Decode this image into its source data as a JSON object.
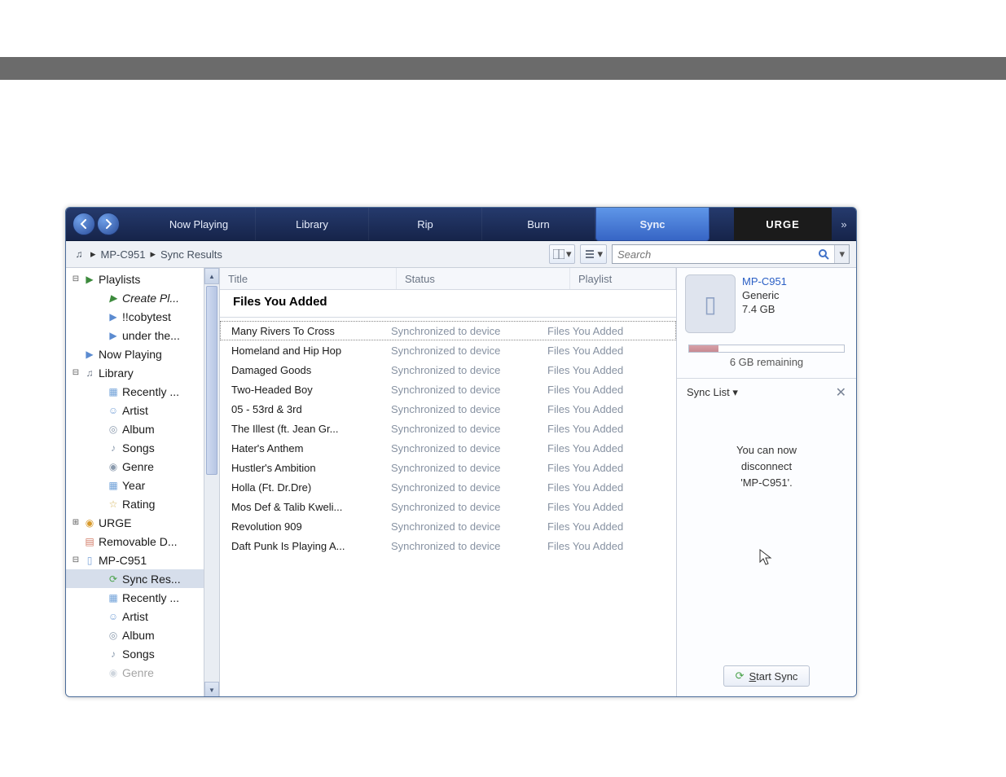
{
  "toolbar": {
    "tabs": [
      "Now Playing",
      "Library",
      "Rip",
      "Burn",
      "Sync"
    ],
    "active_index": 4,
    "urge": "URGE"
  },
  "breadcrumb": {
    "segments": [
      "MP-C951",
      "Sync Results"
    ]
  },
  "search": {
    "placeholder": "Search"
  },
  "tree": {
    "playlists": {
      "label": "Playlists",
      "children": [
        "Create Pl...",
        "!!cobytest",
        "under the..."
      ]
    },
    "now_playing": "Now Playing",
    "library": {
      "label": "Library",
      "children": [
        "Recently ...",
        "Artist",
        "Album",
        "Songs",
        "Genre",
        "Year",
        "Rating"
      ]
    },
    "urge": "URGE",
    "removable": "Removable D...",
    "device": {
      "label": "MP-C951",
      "children": [
        "Sync Res...",
        "Recently ...",
        "Artist",
        "Album",
        "Songs",
        "Genre"
      ]
    },
    "selected": "Sync Res..."
  },
  "columns": {
    "title": "Title",
    "status": "Status",
    "playlist": "Playlist"
  },
  "group_header": "Files You Added",
  "rows": [
    {
      "title": "Many Rivers To Cross",
      "status": "Synchronized to device",
      "playlist": "Files You Added"
    },
    {
      "title": "Homeland and Hip Hop",
      "status": "Synchronized to device",
      "playlist": "Files You Added"
    },
    {
      "title": "Damaged Goods",
      "status": "Synchronized to device",
      "playlist": "Files You Added"
    },
    {
      "title": "Two-Headed Boy",
      "status": "Synchronized to device",
      "playlist": "Files You Added"
    },
    {
      "title": "05 - 53rd & 3rd",
      "status": "Synchronized to device",
      "playlist": "Files You Added"
    },
    {
      "title": "The Illest (ft. Jean Gr...",
      "status": "Synchronized to device",
      "playlist": "Files You Added"
    },
    {
      "title": "Hater's Anthem",
      "status": "Synchronized to device",
      "playlist": "Files You Added"
    },
    {
      "title": "Hustler's Ambition",
      "status": "Synchronized to device",
      "playlist": "Files You Added"
    },
    {
      "title": "Holla (Ft. Dr.Dre)",
      "status": "Synchronized to device",
      "playlist": "Files You Added"
    },
    {
      "title": "Mos Def & Talib Kweli...",
      "status": "Synchronized to device",
      "playlist": "Files You Added"
    },
    {
      "title": "Revolution 909",
      "status": "Synchronized to device",
      "playlist": "Files You Added"
    },
    {
      "title": "Daft Punk Is Playing A...",
      "status": "Synchronized to device",
      "playlist": "Files You Added"
    }
  ],
  "device_panel": {
    "name": "MP-C951",
    "vendor": "Generic",
    "capacity": "7.4 GB",
    "remaining": "6 GB remaining",
    "sync_list_label": "Sync List",
    "message1": "You can now",
    "message2": "disconnect",
    "message3": "'MP-C951'.",
    "start_sync": "Start Sync"
  }
}
